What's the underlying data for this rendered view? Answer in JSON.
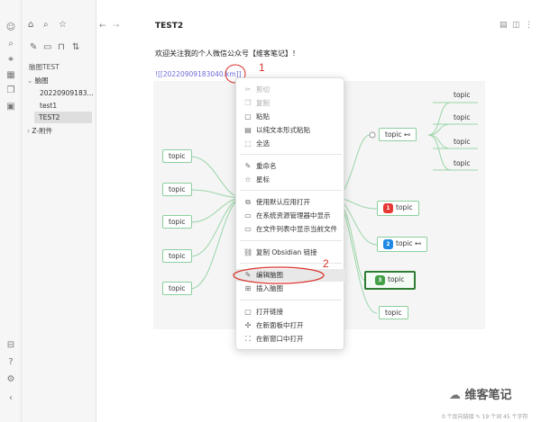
{
  "ribbon": {
    "icons": [
      "smile-icon",
      "search-icon",
      "graph-icon",
      "calendar-icon",
      "copy-icon",
      "terminal-icon",
      "bookmark-icon",
      "help-icon",
      "settings-icon",
      "collapse-icon"
    ]
  },
  "sidebar": {
    "vault_name": "脑图TEST",
    "items": [
      {
        "label": "脑图",
        "type": "folder-open"
      },
      {
        "label": "20220909183...",
        "type": "file"
      },
      {
        "label": "test1",
        "type": "file"
      },
      {
        "label": "TEST2",
        "type": "file",
        "selected": true
      },
      {
        "label": "Z-附件",
        "type": "folder-closed"
      }
    ]
  },
  "editor": {
    "title": "TEST2",
    "intro": "欢迎关注我的个人微信公众号【维客笔记】！",
    "embed": "![[20220909183040.km]]"
  },
  "mindmap": {
    "left_nodes": [
      "topic",
      "topic",
      "topic",
      "topic",
      "topic"
    ],
    "right_nodes": [
      {
        "label": "topic",
        "badge": ""
      },
      {
        "label": "topic",
        "badge": "1",
        "badge_color": "#e53935"
      },
      {
        "label": "topic",
        "badge": "2",
        "badge_color": "#1e88e5"
      },
      {
        "label": "topic",
        "badge": "3",
        "badge_color": "#43a047"
      },
      {
        "label": "topic",
        "badge": ""
      }
    ],
    "leaves": [
      "topic",
      "topic",
      "topic",
      "topic"
    ]
  },
  "context_menu": {
    "items": [
      {
        "label": "剪切",
        "icon": "scissors-icon",
        "disabled": true
      },
      {
        "label": "复制",
        "icon": "copy-icon",
        "disabled": true
      },
      {
        "label": "粘贴",
        "icon": "clipboard-icon"
      },
      {
        "label": "以纯文本形式粘贴",
        "icon": "clipboard-text-icon"
      },
      {
        "label": "全选",
        "icon": "select-all-icon"
      },
      {
        "label": "重命名",
        "icon": "pencil-icon"
      },
      {
        "label": "星标",
        "icon": "star-icon"
      },
      {
        "label": "使用默认应用打开",
        "icon": "external-open-icon"
      },
      {
        "label": "在系统资源管理器中显示",
        "icon": "folder-show-icon"
      },
      {
        "label": "在文件列表中显示当前文件",
        "icon": "file-list-icon"
      },
      {
        "label": "复制 Obsidian 链接",
        "icon": "link-icon"
      },
      {
        "label": "编辑脑图",
        "icon": "edit-mindmap-icon"
      },
      {
        "label": "插入脑图",
        "icon": "insert-mindmap-icon"
      },
      {
        "label": "打开链接",
        "icon": "open-link-icon"
      },
      {
        "label": "在新面板中打开",
        "icon": "split-pane-icon"
      },
      {
        "label": "在新窗口中打开",
        "icon": "new-window-icon"
      }
    ]
  },
  "annotations": {
    "one": "1",
    "two": "2"
  },
  "status": {
    "text": "0 个反向链接  ✎ 19 个词  45 个字符"
  },
  "watermark": {
    "text": "维客笔记"
  },
  "colors": {
    "accent_green": "#8ccf9f",
    "link": "#6b6bd6",
    "annotation": "#d9302a"
  }
}
